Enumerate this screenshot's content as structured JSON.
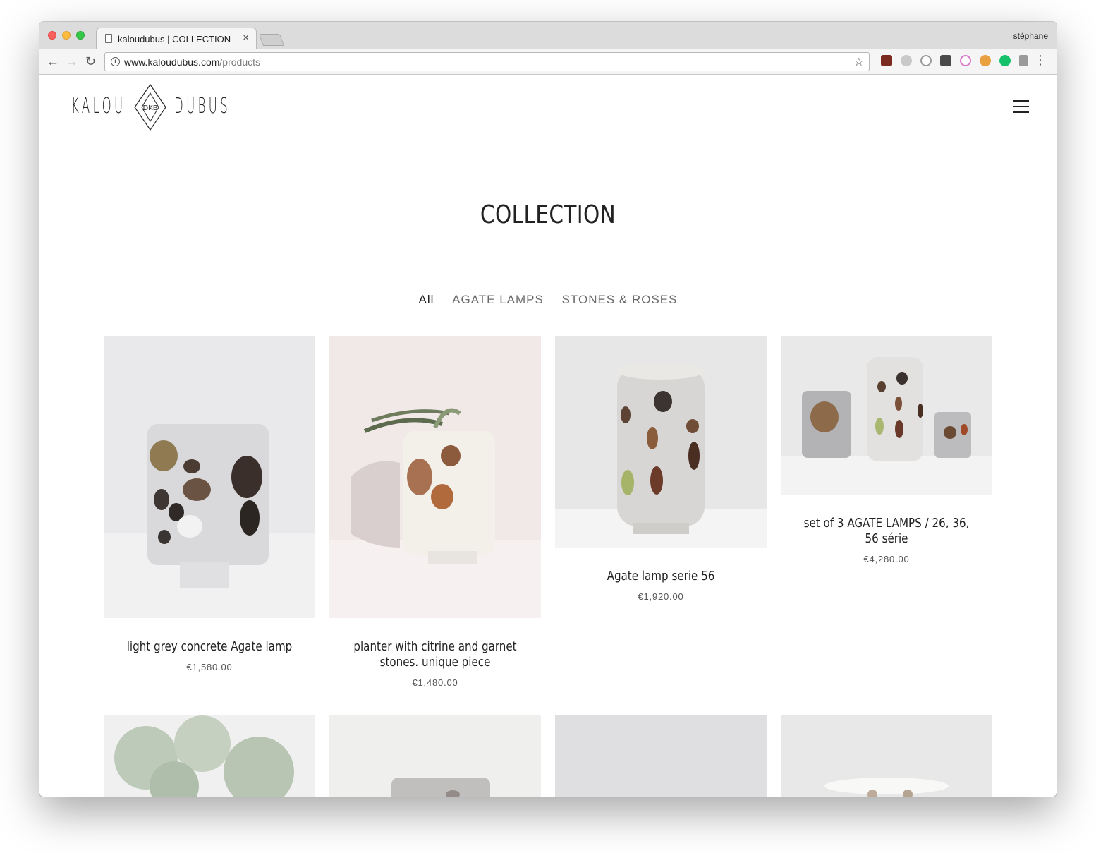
{
  "browser": {
    "tab_title": "kaloudubus | COLLECTION",
    "tab_close": "×",
    "profile_name": "stéphane",
    "url_domain": "www.kaloudubus.com",
    "url_path": "/products",
    "icons": [
      "back-arrow-icon",
      "forward-arrow-icon",
      "reload-icon",
      "info-icon",
      "star-icon",
      "menu-dots-icon"
    ]
  },
  "site": {
    "logo_left": "KALOU",
    "logo_right": "DUBUS",
    "logo_mark": "DKB"
  },
  "page": {
    "title": "COLLECTION",
    "filters": [
      "All",
      "AGATE LAMPS",
      "STONES & ROSES"
    ],
    "active_filter": "All"
  },
  "products": [
    {
      "name": "light grey concrete Agate lamp",
      "price": "€1,580.00"
    },
    {
      "name": "planter with citrine and garnet stones. unique piece",
      "price": "€1,480.00"
    },
    {
      "name": "Agate lamp serie 56",
      "price": "€1,920.00"
    },
    {
      "name": "set of 3 AGATE LAMPS / 26, 36, 56 série",
      "price": "€4,280.00"
    }
  ],
  "colors": {
    "text": "#222222",
    "muted": "#6a6a6a",
    "price": "#555555",
    "tab_bar": "#dcdcdc",
    "toolbar": "#f5f5f5"
  }
}
